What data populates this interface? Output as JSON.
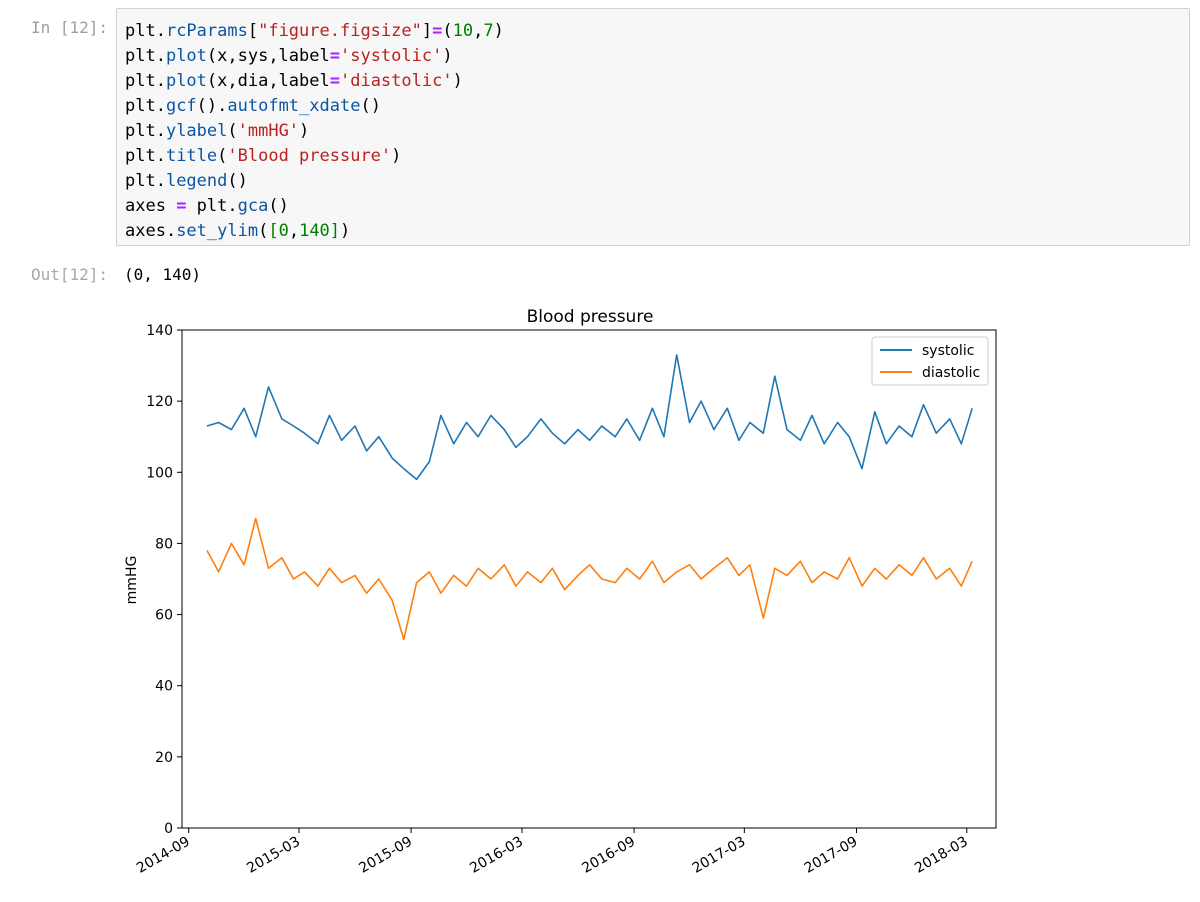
{
  "input_cell": {
    "prompt": "In [12]:",
    "lines": [
      [
        [
          "plt.",
          ""
        ],
        [
          "rcParams",
          "fn"
        ],
        [
          "[",
          ""
        ],
        [
          "\"figure.figsize\"",
          "str"
        ],
        [
          "]",
          ""
        ],
        [
          "=",
          "op"
        ],
        [
          "(",
          ""
        ],
        [
          "10",
          "num"
        ],
        [
          ",",
          ""
        ],
        [
          "7",
          "num"
        ],
        [
          ")",
          ""
        ]
      ],
      [
        [
          "plt.",
          ""
        ],
        [
          "plot",
          "fn"
        ],
        [
          "(x,sys,label",
          ""
        ],
        [
          "=",
          "op"
        ],
        [
          "'systolic'",
          "str"
        ],
        [
          ")",
          ""
        ]
      ],
      [
        [
          "plt.",
          ""
        ],
        [
          "plot",
          "fn"
        ],
        [
          "(x,dia,label",
          ""
        ],
        [
          "=",
          "op"
        ],
        [
          "'diastolic'",
          "str"
        ],
        [
          ")",
          ""
        ]
      ],
      [
        [
          "plt.",
          ""
        ],
        [
          "gcf",
          "fn"
        ],
        [
          "().",
          ""
        ],
        [
          "autofmt_xdate",
          "fn"
        ],
        [
          "()",
          ""
        ]
      ],
      [
        [
          "plt.",
          ""
        ],
        [
          "ylabel",
          "fn"
        ],
        [
          "(",
          ""
        ],
        [
          "'mmHG'",
          "str"
        ],
        [
          ")",
          ""
        ]
      ],
      [
        [
          "plt.",
          ""
        ],
        [
          "title",
          "fn"
        ],
        [
          "(",
          ""
        ],
        [
          "'Blood pressure'",
          "str"
        ],
        [
          ")",
          ""
        ]
      ],
      [
        [
          "plt.",
          ""
        ],
        [
          "legend",
          "fn"
        ],
        [
          "()",
          ""
        ]
      ],
      [
        [
          "axes ",
          ""
        ],
        [
          "=",
          "op"
        ],
        [
          " plt.",
          ""
        ],
        [
          "gca",
          "fn"
        ],
        [
          "()",
          ""
        ]
      ],
      [
        [
          "axes.",
          ""
        ],
        [
          "set_ylim",
          "fn"
        ],
        [
          "(",
          ""
        ],
        [
          "[",
          "brk"
        ],
        [
          "0",
          "num"
        ],
        [
          ",",
          ""
        ],
        [
          "140",
          "num"
        ],
        [
          "]",
          "brk"
        ],
        [
          ")",
          ""
        ]
      ]
    ]
  },
  "output_cell": {
    "prompt": "Out[12]:",
    "text": "(0, 140)"
  },
  "chart_data": {
    "type": "line",
    "title": "Blood pressure",
    "xlabel": "",
    "ylabel": "mmHG",
    "ylim": [
      0,
      140
    ],
    "yticks": [
      0,
      20,
      40,
      60,
      80,
      100,
      120,
      140
    ],
    "xlim": [
      "2014-08-21",
      "2018-04-18"
    ],
    "xticks": [
      "2014-09",
      "2015-03",
      "2015-09",
      "2016-03",
      "2016-09",
      "2017-03",
      "2017-09",
      "2018-03"
    ],
    "legend_position": "top-right",
    "grid": false,
    "series": [
      {
        "name": "systolic",
        "color": "#1f77b4",
        "x": [
          "2014-10-01",
          "2014-10-20",
          "2014-11-10",
          "2014-12-01",
          "2014-12-20",
          "2015-01-10",
          "2015-02-01",
          "2015-02-20",
          "2015-03-10",
          "2015-04-01",
          "2015-04-20",
          "2015-05-10",
          "2015-06-01",
          "2015-06-20",
          "2015-07-10",
          "2015-08-01",
          "2015-08-20",
          "2015-09-10",
          "2015-10-01",
          "2015-10-20",
          "2015-11-10",
          "2015-12-01",
          "2015-12-20",
          "2016-01-10",
          "2016-02-01",
          "2016-02-20",
          "2016-03-10",
          "2016-04-01",
          "2016-04-20",
          "2016-05-10",
          "2016-06-01",
          "2016-06-20",
          "2016-07-10",
          "2016-08-01",
          "2016-08-20",
          "2016-09-10",
          "2016-10-01",
          "2016-10-20",
          "2016-11-10",
          "2016-12-01",
          "2016-12-20",
          "2017-01-10",
          "2017-02-01",
          "2017-02-20",
          "2017-03-10",
          "2017-04-01",
          "2017-04-20",
          "2017-05-10",
          "2017-06-01",
          "2017-06-20",
          "2017-07-10",
          "2017-08-01",
          "2017-08-20",
          "2017-09-10",
          "2017-10-01",
          "2017-10-20",
          "2017-11-10",
          "2017-12-01",
          "2017-12-20",
          "2018-01-10",
          "2018-02-01",
          "2018-02-20",
          "2018-03-10"
        ],
        "values": [
          113,
          114,
          112,
          118,
          110,
          124,
          115,
          113,
          111,
          108,
          116,
          109,
          113,
          106,
          110,
          104,
          101,
          98,
          103,
          116,
          108,
          114,
          110,
          116,
          112,
          107,
          110,
          115,
          111,
          108,
          112,
          109,
          113,
          110,
          115,
          109,
          118,
          110,
          133,
          114,
          120,
          112,
          118,
          109,
          114,
          111,
          127,
          112,
          109,
          116,
          108,
          114,
          110,
          101,
          117,
          108,
          113,
          110,
          119,
          111,
          115,
          108,
          118
        ]
      },
      {
        "name": "diastolic",
        "color": "#ff7f0e",
        "x": [
          "2014-10-01",
          "2014-10-20",
          "2014-11-10",
          "2014-12-01",
          "2014-12-20",
          "2015-01-10",
          "2015-02-01",
          "2015-02-20",
          "2015-03-10",
          "2015-04-01",
          "2015-04-20",
          "2015-05-10",
          "2015-06-01",
          "2015-06-20",
          "2015-07-10",
          "2015-08-01",
          "2015-08-20",
          "2015-09-10",
          "2015-10-01",
          "2015-10-20",
          "2015-11-10",
          "2015-12-01",
          "2015-12-20",
          "2016-01-10",
          "2016-02-01",
          "2016-02-20",
          "2016-03-10",
          "2016-04-01",
          "2016-04-20",
          "2016-05-10",
          "2016-06-01",
          "2016-06-20",
          "2016-07-10",
          "2016-08-01",
          "2016-08-20",
          "2016-09-10",
          "2016-10-01",
          "2016-10-20",
          "2016-11-10",
          "2016-12-01",
          "2016-12-20",
          "2017-01-10",
          "2017-02-01",
          "2017-02-20",
          "2017-03-10",
          "2017-04-01",
          "2017-04-20",
          "2017-05-10",
          "2017-06-01",
          "2017-06-20",
          "2017-07-10",
          "2017-08-01",
          "2017-08-20",
          "2017-09-10",
          "2017-10-01",
          "2017-10-20",
          "2017-11-10",
          "2017-12-01",
          "2017-12-20",
          "2018-01-10",
          "2018-02-01",
          "2018-02-20",
          "2018-03-10"
        ],
        "values": [
          78,
          72,
          80,
          74,
          87,
          73,
          76,
          70,
          72,
          68,
          73,
          69,
          71,
          66,
          70,
          64,
          53,
          69,
          72,
          66,
          71,
          68,
          73,
          70,
          74,
          68,
          72,
          69,
          73,
          67,
          71,
          74,
          70,
          69,
          73,
          70,
          75,
          69,
          72,
          74,
          70,
          73,
          76,
          71,
          74,
          59,
          73,
          71,
          75,
          69,
          72,
          70,
          76,
          68,
          73,
          70,
          74,
          71,
          76,
          70,
          73,
          68,
          75
        ]
      }
    ]
  }
}
